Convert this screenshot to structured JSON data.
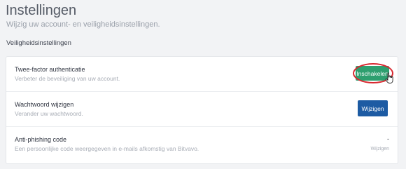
{
  "header": {
    "title": "Instellingen",
    "subtitle": "Wijzig uw account- en veiligheidsinstellingen."
  },
  "section": {
    "title": "Veiligheidsinstellingen"
  },
  "rows": [
    {
      "title": "Twee-factor authenticatie",
      "description": "Verbeter de beveiliging van uw account.",
      "action_label": "Inschakelen"
    },
    {
      "title": "Wachtwoord wijzigen",
      "description": "Verander uw wachtwoord.",
      "action_label": "Wijzigen"
    },
    {
      "title": "Anti-phishing code",
      "description": "Een persoonlijke code weergegeven in e-mails afkomstig van Bitvavo.",
      "value": "-",
      "action_label": "Wijzigen"
    }
  ],
  "colors": {
    "enable_button": "#2e9f6f",
    "change_button": "#1d5ba3",
    "highlight": "#d8272f"
  }
}
